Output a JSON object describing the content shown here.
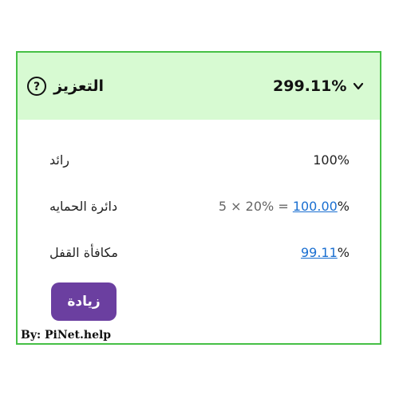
{
  "header": {
    "title": "التعزيز",
    "value": "299.11%"
  },
  "rows": [
    {
      "label": "رائد",
      "value": "100%"
    },
    {
      "label": "دائرة الحمايه",
      "formula": "5 × 20% = ",
      "value_link": "100.00",
      "suffix": "%"
    },
    {
      "label": "مكافأة القفل",
      "value_link": "99.11",
      "suffix": "%"
    }
  ],
  "action_button": {
    "label": "زيادة"
  },
  "watermark": "By: PiNet.help",
  "colors": {
    "header_bg": "#d7fad2",
    "border": "#46c046",
    "button_bg": "#6b3fa0",
    "link": "#1a6fd1"
  },
  "icons": {
    "help": "question-circle-icon",
    "expand": "chevron-down-icon"
  }
}
